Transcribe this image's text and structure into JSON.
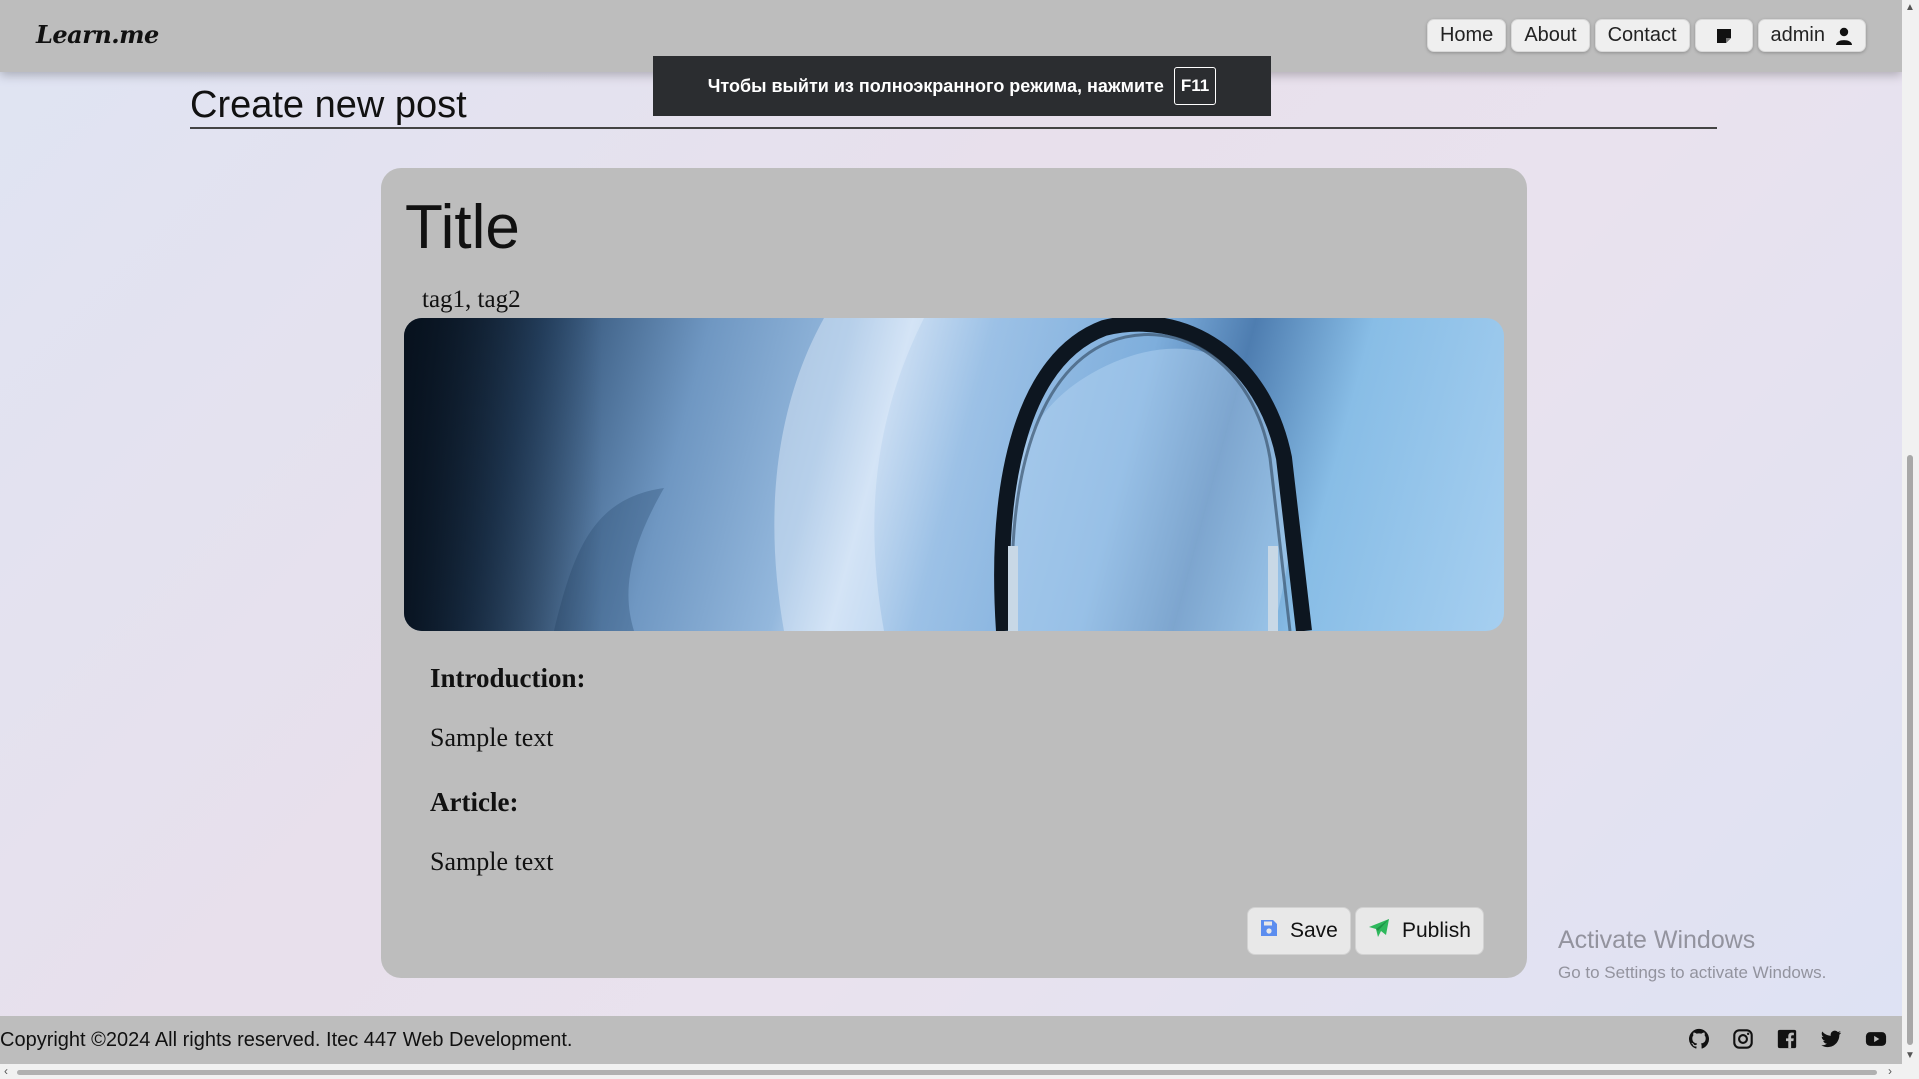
{
  "brand": "Learn.me",
  "nav": {
    "home": "Home",
    "about": "About",
    "contact": "Contact",
    "user": "admin"
  },
  "fullscreen_notice": {
    "text": "Чтобы выйти из полноэкранного режима, нажмите",
    "key": "F11"
  },
  "page": {
    "title": "Create new post"
  },
  "post": {
    "title": "Title",
    "tags": "tag1, tag2",
    "intro_heading": "Introduction:",
    "intro_text": "Sample text",
    "article_heading": "Article:",
    "article_text": "Sample text",
    "save_label": "Save",
    "publish_label": "Publish"
  },
  "watermark": {
    "title": "Activate Windows",
    "subtitle": "Go to Settings to activate Windows."
  },
  "footer": {
    "copyright": "Copyright ©2024 All rights reserved. Itec 447 Web Development.",
    "social_icons": [
      "github-icon",
      "instagram-icon",
      "facebook-icon",
      "twitter-icon",
      "youtube-icon"
    ]
  },
  "colors": {
    "save_icon": "#5b8def",
    "publish_icon": "#2eb85c",
    "navbar_bg": "#bdbdbd",
    "card_bg": "#bdbdbd"
  }
}
